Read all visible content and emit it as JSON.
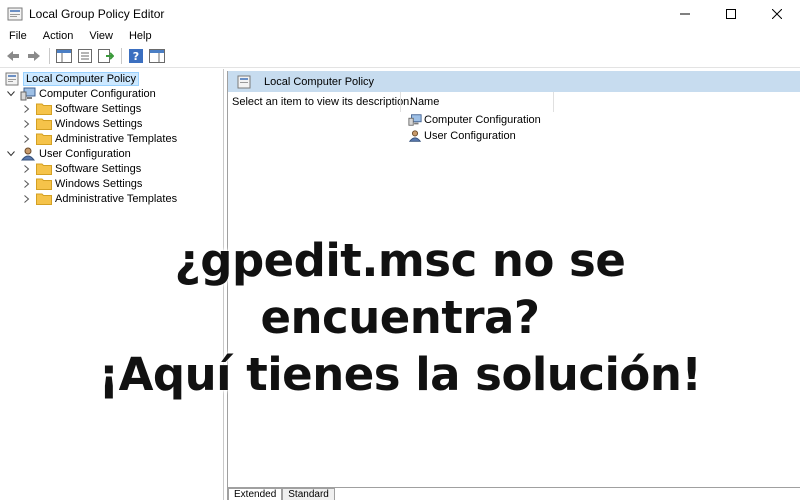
{
  "window": {
    "title": "Local Group Policy Editor"
  },
  "menu": [
    "File",
    "Action",
    "View",
    "Help"
  ],
  "toolbar": {
    "buttons": [
      "back-arrow-icon",
      "forward-arrow-icon",
      "show-hide-console-tree-icon",
      "properties-icon",
      "export-list-icon",
      "help-icon",
      "show-hide-action-pane-icon"
    ]
  },
  "tree": {
    "root": "Local Computer Policy",
    "computer_config": "Computer Configuration",
    "computer_children": [
      "Software Settings",
      "Windows Settings",
      "Administrative Templates"
    ],
    "user_config": "User Configuration",
    "user_children": [
      "Software Settings",
      "Windows Settings",
      "Administrative Templates"
    ]
  },
  "right_pane": {
    "header": "Local Computer Policy",
    "description": "Select an item to view its description.",
    "column_name": "Name",
    "items": [
      "Computer Configuration",
      "User Configuration"
    ]
  },
  "tabs": [
    "Extended",
    "Standard"
  ],
  "overlay": {
    "line1": "¿gpedit.msc no se",
    "line2": "encuentra?",
    "line3": "¡Aquí tienes la solución!"
  },
  "colors": {
    "selection": "#cce8ff",
    "pane_header": "#c7dcef",
    "folder": "#f5c34a"
  }
}
